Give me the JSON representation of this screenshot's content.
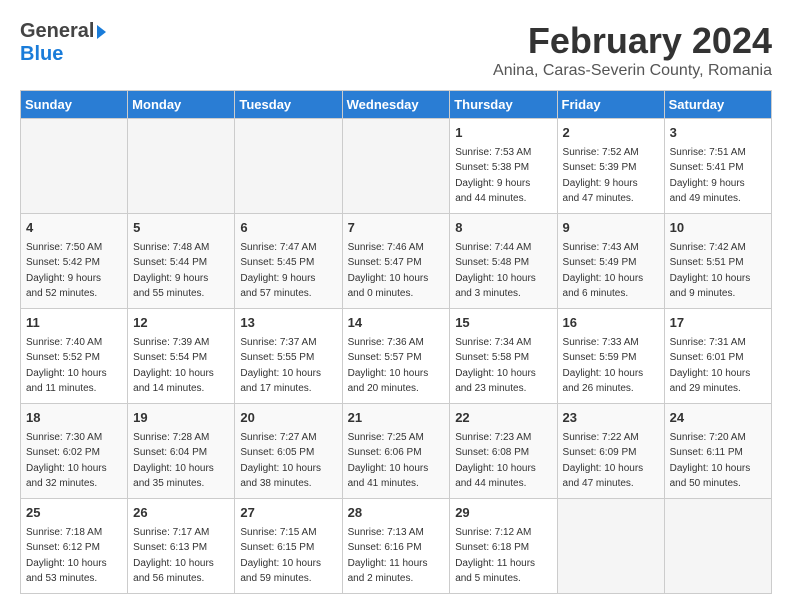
{
  "header": {
    "logo_general": "General",
    "logo_blue": "Blue",
    "month_title": "February 2024",
    "location": "Anina, Caras-Severin County, Romania"
  },
  "calendar": {
    "days_of_week": [
      "Sunday",
      "Monday",
      "Tuesday",
      "Wednesday",
      "Thursday",
      "Friday",
      "Saturday"
    ],
    "weeks": [
      [
        {
          "day": "",
          "info": ""
        },
        {
          "day": "",
          "info": ""
        },
        {
          "day": "",
          "info": ""
        },
        {
          "day": "",
          "info": ""
        },
        {
          "day": "1",
          "info": "Sunrise: 7:53 AM\nSunset: 5:38 PM\nDaylight: 9 hours\nand 44 minutes."
        },
        {
          "day": "2",
          "info": "Sunrise: 7:52 AM\nSunset: 5:39 PM\nDaylight: 9 hours\nand 47 minutes."
        },
        {
          "day": "3",
          "info": "Sunrise: 7:51 AM\nSunset: 5:41 PM\nDaylight: 9 hours\nand 49 minutes."
        }
      ],
      [
        {
          "day": "4",
          "info": "Sunrise: 7:50 AM\nSunset: 5:42 PM\nDaylight: 9 hours\nand 52 minutes."
        },
        {
          "day": "5",
          "info": "Sunrise: 7:48 AM\nSunset: 5:44 PM\nDaylight: 9 hours\nand 55 minutes."
        },
        {
          "day": "6",
          "info": "Sunrise: 7:47 AM\nSunset: 5:45 PM\nDaylight: 9 hours\nand 57 minutes."
        },
        {
          "day": "7",
          "info": "Sunrise: 7:46 AM\nSunset: 5:47 PM\nDaylight: 10 hours\nand 0 minutes."
        },
        {
          "day": "8",
          "info": "Sunrise: 7:44 AM\nSunset: 5:48 PM\nDaylight: 10 hours\nand 3 minutes."
        },
        {
          "day": "9",
          "info": "Sunrise: 7:43 AM\nSunset: 5:49 PM\nDaylight: 10 hours\nand 6 minutes."
        },
        {
          "day": "10",
          "info": "Sunrise: 7:42 AM\nSunset: 5:51 PM\nDaylight: 10 hours\nand 9 minutes."
        }
      ],
      [
        {
          "day": "11",
          "info": "Sunrise: 7:40 AM\nSunset: 5:52 PM\nDaylight: 10 hours\nand 11 minutes."
        },
        {
          "day": "12",
          "info": "Sunrise: 7:39 AM\nSunset: 5:54 PM\nDaylight: 10 hours\nand 14 minutes."
        },
        {
          "day": "13",
          "info": "Sunrise: 7:37 AM\nSunset: 5:55 PM\nDaylight: 10 hours\nand 17 minutes."
        },
        {
          "day": "14",
          "info": "Sunrise: 7:36 AM\nSunset: 5:57 PM\nDaylight: 10 hours\nand 20 minutes."
        },
        {
          "day": "15",
          "info": "Sunrise: 7:34 AM\nSunset: 5:58 PM\nDaylight: 10 hours\nand 23 minutes."
        },
        {
          "day": "16",
          "info": "Sunrise: 7:33 AM\nSunset: 5:59 PM\nDaylight: 10 hours\nand 26 minutes."
        },
        {
          "day": "17",
          "info": "Sunrise: 7:31 AM\nSunset: 6:01 PM\nDaylight: 10 hours\nand 29 minutes."
        }
      ],
      [
        {
          "day": "18",
          "info": "Sunrise: 7:30 AM\nSunset: 6:02 PM\nDaylight: 10 hours\nand 32 minutes."
        },
        {
          "day": "19",
          "info": "Sunrise: 7:28 AM\nSunset: 6:04 PM\nDaylight: 10 hours\nand 35 minutes."
        },
        {
          "day": "20",
          "info": "Sunrise: 7:27 AM\nSunset: 6:05 PM\nDaylight: 10 hours\nand 38 minutes."
        },
        {
          "day": "21",
          "info": "Sunrise: 7:25 AM\nSunset: 6:06 PM\nDaylight: 10 hours\nand 41 minutes."
        },
        {
          "day": "22",
          "info": "Sunrise: 7:23 AM\nSunset: 6:08 PM\nDaylight: 10 hours\nand 44 minutes."
        },
        {
          "day": "23",
          "info": "Sunrise: 7:22 AM\nSunset: 6:09 PM\nDaylight: 10 hours\nand 47 minutes."
        },
        {
          "day": "24",
          "info": "Sunrise: 7:20 AM\nSunset: 6:11 PM\nDaylight: 10 hours\nand 50 minutes."
        }
      ],
      [
        {
          "day": "25",
          "info": "Sunrise: 7:18 AM\nSunset: 6:12 PM\nDaylight: 10 hours\nand 53 minutes."
        },
        {
          "day": "26",
          "info": "Sunrise: 7:17 AM\nSunset: 6:13 PM\nDaylight: 10 hours\nand 56 minutes."
        },
        {
          "day": "27",
          "info": "Sunrise: 7:15 AM\nSunset: 6:15 PM\nDaylight: 10 hours\nand 59 minutes."
        },
        {
          "day": "28",
          "info": "Sunrise: 7:13 AM\nSunset: 6:16 PM\nDaylight: 11 hours\nand 2 minutes."
        },
        {
          "day": "29",
          "info": "Sunrise: 7:12 AM\nSunset: 6:18 PM\nDaylight: 11 hours\nand 5 minutes."
        },
        {
          "day": "",
          "info": ""
        },
        {
          "day": "",
          "info": ""
        }
      ]
    ]
  }
}
